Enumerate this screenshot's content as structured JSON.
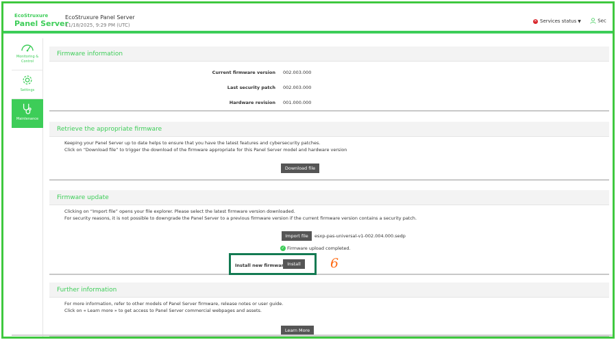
{
  "header": {
    "logo_small": "EcoStruxure",
    "logo_big": "Panel Server",
    "app_title": "EcoStruxure Panel Server",
    "date": "11/18/2025, 9:29 PM (UTC)",
    "services_status": "Services status",
    "user_label": "Sec"
  },
  "sidebar": {
    "items": [
      {
        "label": "Monitoring & Control",
        "icon": "gauge-icon"
      },
      {
        "label": "Settings",
        "icon": "gear-icon"
      },
      {
        "label": "Maintenance",
        "icon": "stethoscope-icon"
      }
    ]
  },
  "firmware_info": {
    "title": "Firmware information",
    "rows": [
      {
        "label": "Current firmware version",
        "value": "002.003.000"
      },
      {
        "label": "Last security patch",
        "value": "002.003.000"
      },
      {
        "label": "Hardware revision",
        "value": "001.000.000"
      }
    ]
  },
  "retrieve": {
    "title": "Retrieve the appropriate firmware",
    "line1": "Keeping your Panel Server up to date helps to ensure that you have the latest features and cybersecurity patches.",
    "line2": "Click on “Download file” to trigger the download of the firmware appropriate for this Panel Server model and hardware version",
    "button": "Download file"
  },
  "update": {
    "title": "Firmware update",
    "line1": "Clicking on “Import file” opens your file explorer. Please select the latest firmware version downloaded.",
    "line2": "For security reasons, it is not possible to downgrade the Panel Server to a previous firmware version if the current firmware version contains a security patch.",
    "import_button": "Import file",
    "filename": "esxp-pas-universal-v1-002.004.000.sedp",
    "upload_status": "Firmware upload completed.",
    "install_label": "Install new firmware",
    "install_button": "Install"
  },
  "annotation": "6",
  "further": {
    "title": "Further information",
    "line1": "For more information, refer to other models of Panel Server firmware, release notes or user guide.",
    "line2": "Click on « Learn more » to get access to Panel Server commercial webpages and assets.",
    "button": "Learn More"
  },
  "colors": {
    "brand_green": "#3dcd58",
    "frame_green": "#3ec83e",
    "annotation_box": "#137a52",
    "annotation_text": "#ff6a13",
    "button": "#555555"
  }
}
